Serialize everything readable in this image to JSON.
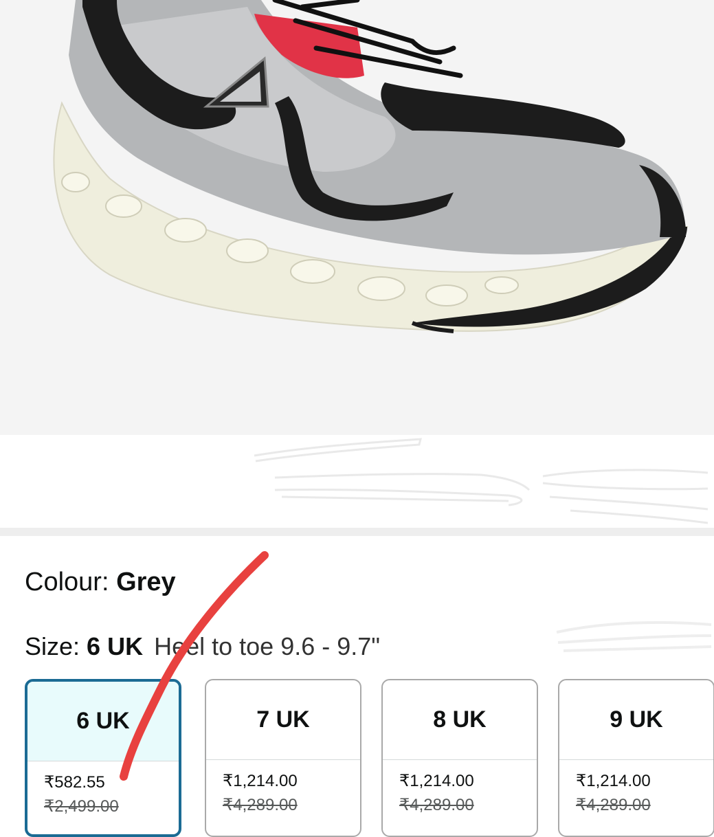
{
  "product_image": {
    "alt_icon": "sneaker-image"
  },
  "colour": {
    "label": "Colour: ",
    "value": "Grey"
  },
  "size": {
    "label": "Size: ",
    "value": "6 UK",
    "fit_note": "Heel to toe 9.6 - 9.7\""
  },
  "size_options": [
    {
      "size": "6 UK",
      "price": "₹582.55",
      "mrp": "₹2,499.00",
      "selected": true
    },
    {
      "size": "7 UK",
      "price": "₹1,214.00",
      "mrp": "₹4,289.00",
      "selected": false
    },
    {
      "size": "8 UK",
      "price": "₹1,214.00",
      "mrp": "₹4,289.00",
      "selected": false
    },
    {
      "size": "9 UK",
      "price": "₹1,214.00",
      "mrp": "₹4,289.00",
      "selected": false
    }
  ],
  "colors": {
    "selected_border": "#1b6b94",
    "annotation_red": "#e8413f"
  }
}
